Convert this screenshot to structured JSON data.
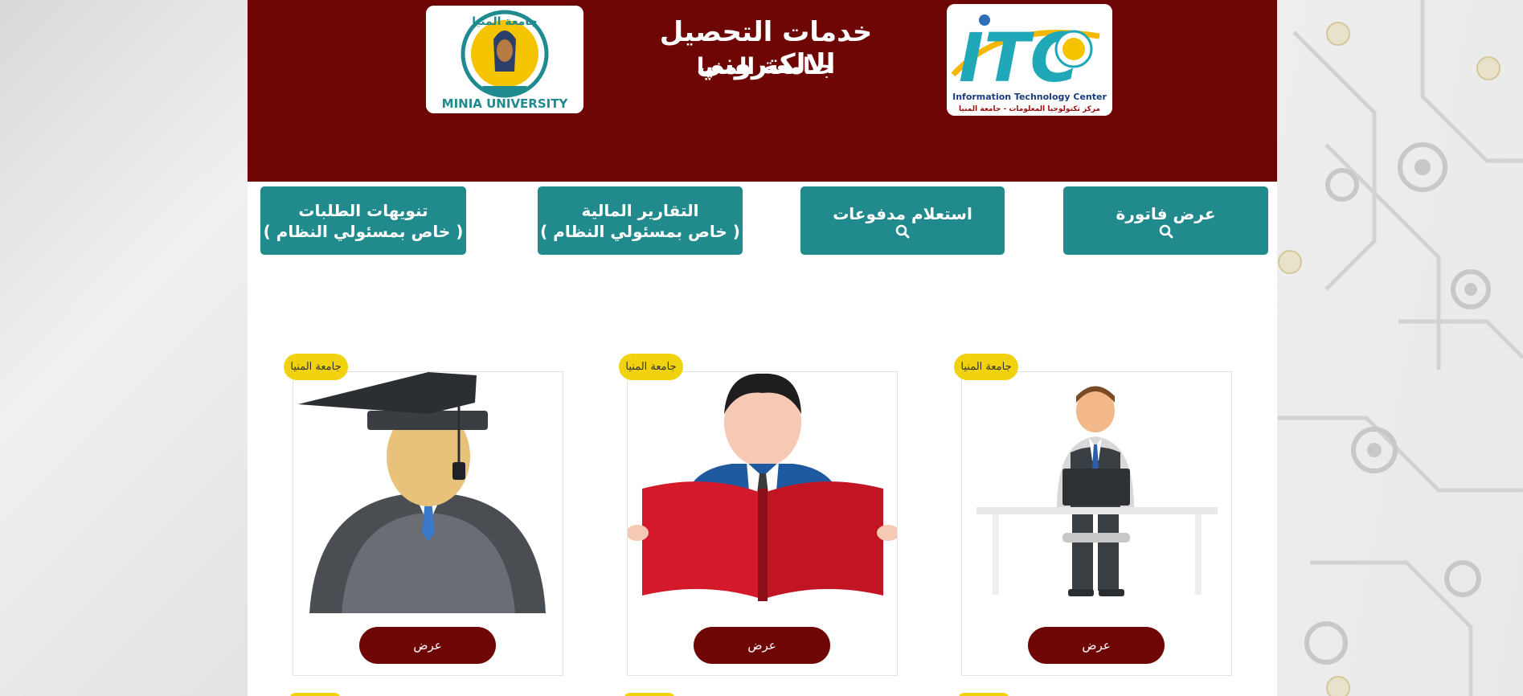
{
  "header": {
    "title": "خدمات التحصيل الالكتروني",
    "subtitle": "جـامعة المنيا",
    "minia_logo": {
      "top_text": "جامعة المنيا",
      "bottom_text": "MINIA UNIVERSITY"
    },
    "itc_logo": {
      "letters": "ITC",
      "line1": "Information Technology Center",
      "line2": "مركز تكنولوجيا المعلومات - جامعة المنيا"
    }
  },
  "nav": {
    "invoice": {
      "label": "عرض فاتورة",
      "icon": "search-icon"
    },
    "payments": {
      "label": "استعلام مدفوعات",
      "icon": "search-icon"
    },
    "reports": {
      "label": "التقارير المالية",
      "note": "( خاص بمسئولي النظام )"
    },
    "notices": {
      "label": "تنويهات الطلبات",
      "note": "( خاص بمسئولي النظام )"
    }
  },
  "cards": [
    {
      "badge": "جامعة المنيا",
      "button": "عرض",
      "image": "employee-at-desk"
    },
    {
      "badge": "جامعة المنيا",
      "button": "عرض",
      "image": "reader-with-book"
    },
    {
      "badge": "جامعة المنيا",
      "button": "عرض",
      "image": "graduate"
    }
  ],
  "colors": {
    "header": "#6e0606",
    "nav": "#218a8c",
    "badge": "#f1d20f"
  }
}
